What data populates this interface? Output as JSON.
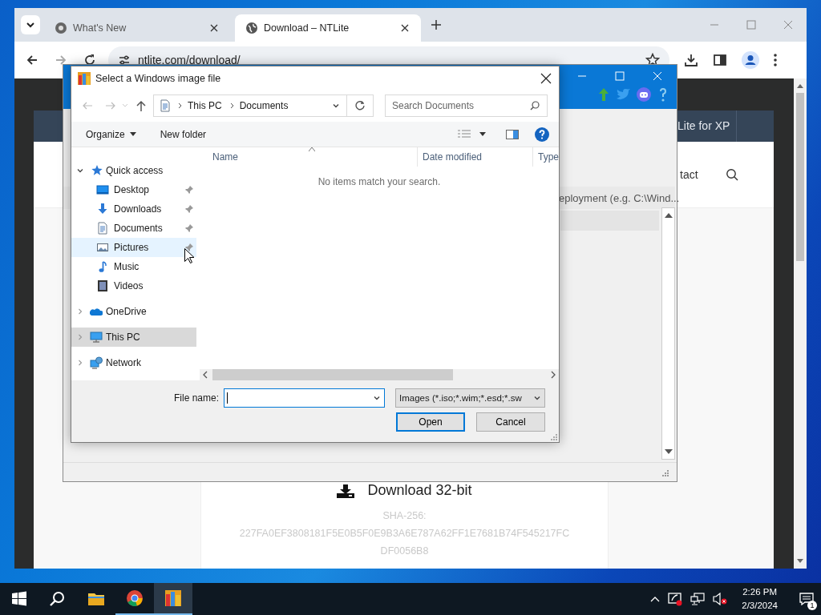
{
  "browser": {
    "tabs": [
      {
        "title": "What's New",
        "selected": false
      },
      {
        "title": "Download – NTLite",
        "selected": true
      }
    ],
    "address": "ntlite.com/download/"
  },
  "webpage": {
    "nav_link": "Lite for XP",
    "header_link": "tact",
    "download_label": "Download 32-bit",
    "hash_label": "SHA-256:",
    "hash_lines": [
      "227FA0EF3808181F5E0B5F0E9B3A6E787A62FF1E7681B74F545217FC",
      "DF0056B8"
    ]
  },
  "app_window": {
    "path_hint": "eployment (e.g. C:\\Wind..."
  },
  "dialog": {
    "title": "Select a Windows image file",
    "breadcrumb": [
      "This PC",
      "Documents"
    ],
    "search": {
      "placeholder": "Search Documents"
    },
    "toolbar": [
      "Organize",
      "New folder"
    ],
    "columns": [
      "Name",
      "Date modified",
      "Type"
    ],
    "empty_message": "No items match your search.",
    "nav": [
      {
        "label": "Quick access",
        "kind": "quick",
        "expanded": true,
        "selected": false,
        "hovered": false,
        "children": [
          {
            "label": "Desktop",
            "kind": "desktop",
            "pinned": true,
            "selected": false,
            "hovered": false
          },
          {
            "label": "Downloads",
            "kind": "downloads",
            "pinned": true,
            "selected": false,
            "hovered": false
          },
          {
            "label": "Documents",
            "kind": "documents",
            "pinned": true,
            "selected": false,
            "hovered": false
          },
          {
            "label": "Pictures",
            "kind": "pictures",
            "pinned": true,
            "selected": false,
            "hovered": true
          },
          {
            "label": "Music",
            "kind": "music",
            "pinned": false,
            "selected": false,
            "hovered": false
          },
          {
            "label": "Videos",
            "kind": "videos",
            "pinned": false,
            "selected": false,
            "hovered": false
          }
        ]
      },
      {
        "label": "OneDrive",
        "kind": "cloud",
        "expanded": false,
        "selected": false,
        "hovered": false
      },
      {
        "label": "This PC",
        "kind": "pc",
        "expanded": false,
        "selected": true,
        "hovered": false
      },
      {
        "label": "Network",
        "kind": "network",
        "expanded": false,
        "selected": false,
        "hovered": false
      }
    ],
    "file_name_label": "File name:",
    "file_type": "Images (*.iso;*.wim;*.esd;*.sw",
    "buttons": [
      {
        "label": "Open",
        "default": true
      },
      {
        "label": "Cancel",
        "default": false
      }
    ]
  },
  "taskbar": {
    "apps": [
      {
        "kind": "start",
        "running": false,
        "active": false
      },
      {
        "kind": "search",
        "running": false,
        "active": false
      },
      {
        "kind": "folder",
        "running": false,
        "active": false
      },
      {
        "kind": "browser",
        "running": true,
        "active": false
      },
      {
        "kind": "app",
        "running": true,
        "active": true
      }
    ],
    "time": "2:26 PM",
    "date": "2/3/2024",
    "notification_count": "1"
  }
}
